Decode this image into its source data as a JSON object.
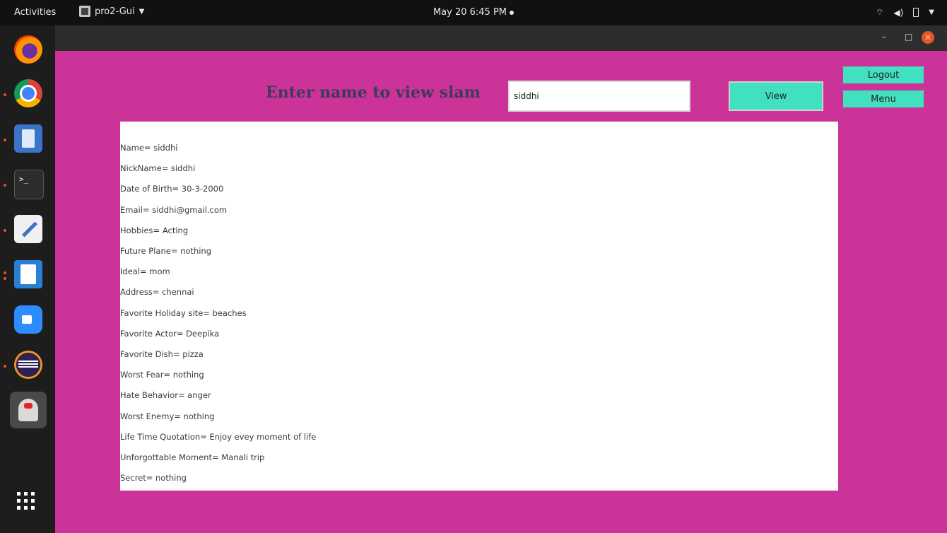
{
  "topbar": {
    "activities": "Activities",
    "app_menu": "pro2-Gui",
    "clock": "May 20  6:45 PM"
  },
  "window": {
    "prompt": "Enter name to view slam",
    "search_value": "siddhi",
    "view_label": "View",
    "logout_label": "Logout",
    "menu_label": "Menu"
  },
  "slam": {
    "fields": [
      "Name= siddhi",
      "NickName= siddhi",
      "Date of Birth= 30-3-2000",
      "Email= siddhi@gmail.com",
      "Hobbies= Acting",
      "Future Plane= nothing",
      "Ideal= mom",
      "Address= chennai",
      "Favorite Holiday site= beaches",
      "Favorite Actor= Deepika",
      "Favorite Dish= pizza",
      "Worst Fear= nothing",
      "Hate Behavior= anger",
      "Worst Enemy= nothing",
      "Life Time Quotation= Enjoy evey moment of life",
      "Unforgottable Moment= Manali trip",
      "Secret= nothing"
    ]
  },
  "colors": {
    "background": "#cc3399",
    "button": "#40e0c0",
    "panel": "#ffffff",
    "prompt_text": "#3b3c5a"
  },
  "icons": {
    "dock": [
      "firefox-icon",
      "chrome-icon",
      "files-icon",
      "terminal-icon",
      "text-editor-icon",
      "impress-icon",
      "zoom-icon",
      "eclipse-icon",
      "java-app-icon",
      "show-apps-icon"
    ],
    "status": [
      "wifi-icon",
      "volume-icon",
      "battery-icon",
      "chevron-down-icon"
    ]
  }
}
